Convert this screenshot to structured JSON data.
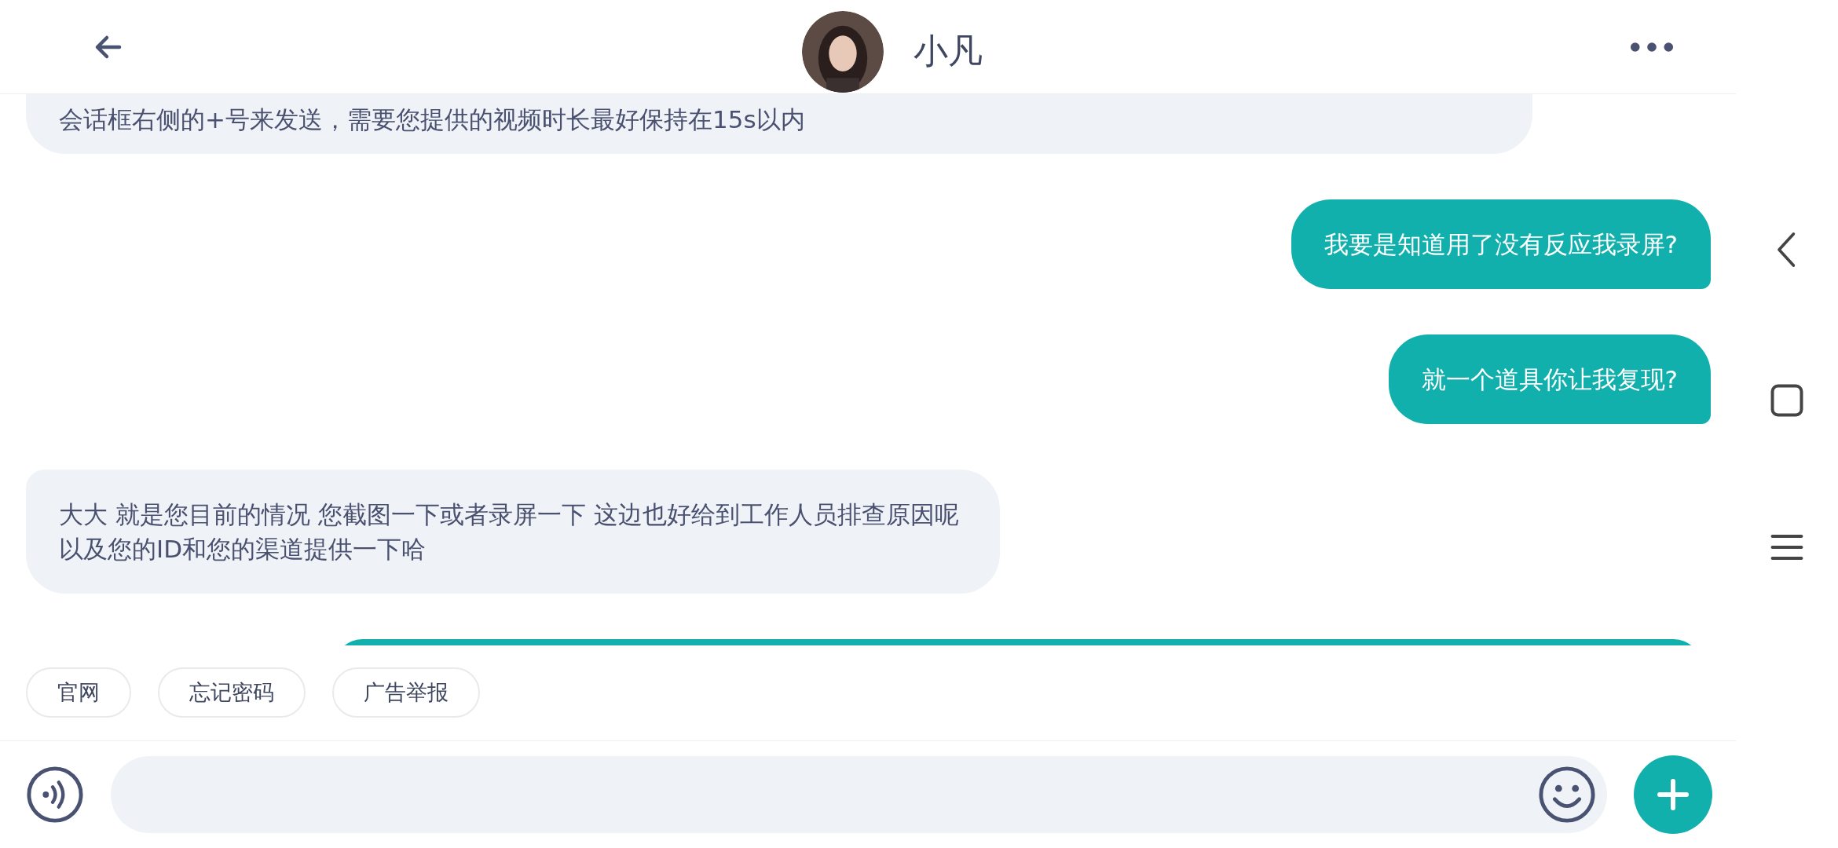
{
  "header": {
    "title": "小凡"
  },
  "messages": [
    {
      "kind": "received",
      "text": "会话框右侧的+号来发送，需要您提供的视频时长最好保持在15s以内"
    },
    {
      "kind": "sent",
      "text": "我要是知道用了没有反应我录屏?"
    },
    {
      "kind": "sent",
      "text": "就一个道具你让我复现?"
    },
    {
      "kind": "received",
      "text": "大大 就是您目前的情况 您截图一下或者录屏一下 这边也好给到工作人员排查原因呢以及您的ID和您的渠道提供一下哈"
    },
    {
      "kind": "sent"
    }
  ],
  "quick_replies": [
    "官网",
    "忘记密码",
    "广告举报"
  ]
}
